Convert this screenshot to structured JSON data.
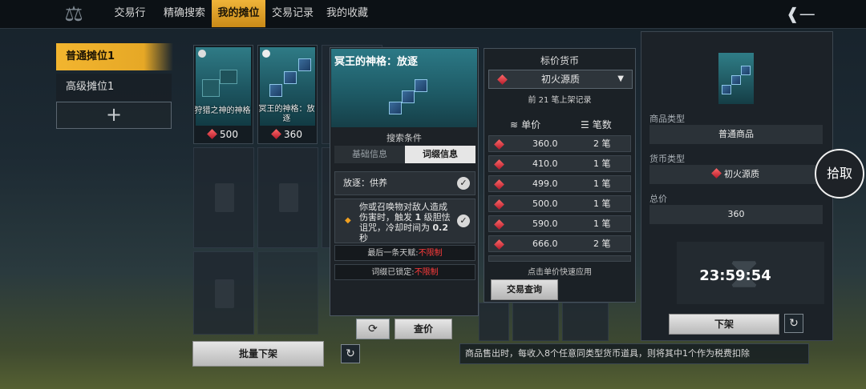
{
  "topbar": {
    "tabs": [
      "交易行",
      "精确搜索",
      "我的摊位",
      "交易记录",
      "我的收藏"
    ],
    "active_tab": "我的摊位",
    "accent": "#f0b43a"
  },
  "sidebar": {
    "stalls": [
      "普通摊位1",
      "高级摊位1"
    ],
    "add_label": "+"
  },
  "listings": [
    {
      "name": "狩猎之神的神格",
      "price": "500"
    },
    {
      "name": "冥王的神格：放逐",
      "price": "360"
    }
  ],
  "bulk_delist_label": "批量下架",
  "search_panel": {
    "item_title": "冥王的神格：放逐",
    "subtitle": "搜索条件",
    "tabs": [
      "基础信息",
      "词缀信息"
    ],
    "active_tab": "词缀信息",
    "affix_1": "放逐：供养",
    "affix_2_prefix": "你或召唤物对敌人造成伤害时，触发 ",
    "affix_2_num": "1",
    "affix_2_mid": " 级胆怯诅咒，冷却时间为 ",
    "affix_2_cd": "0.2",
    "affix_2_suffix": " 秒",
    "last_talent_label": "最后一条天赋:",
    "last_talent_value": "不限制",
    "locked_label": "词缀已锁定:",
    "locked_value": "不限制",
    "check_price_label": "查价"
  },
  "price_panel": {
    "title": "标价货币",
    "currency": "初火源质",
    "note": "前 21 笔上架记录",
    "col_price": "单价",
    "col_count": "笔数",
    "rows": [
      {
        "price": "360.0",
        "count": "2 笔"
      },
      {
        "price": "410.0",
        "count": "1 笔"
      },
      {
        "price": "499.0",
        "count": "1 笔"
      },
      {
        "price": "500.0",
        "count": "1 笔"
      },
      {
        "price": "590.0",
        "count": "1 笔"
      },
      {
        "price": "666.0",
        "count": "2 笔"
      }
    ],
    "hint": "点击单价快速应用",
    "query_label": "交易查询"
  },
  "detail": {
    "type_label": "商品类型",
    "type_value": "普通商品",
    "currency_label": "货币类型",
    "currency_value": "初火源质",
    "total_label": "总价",
    "total_value": "360",
    "timer": "23:59:54",
    "delist_label": "下架"
  },
  "pickup_label": "拾取",
  "tax_note": "商品售出时，每收入8个任意同类型货币道具，则将其中1个作为税费扣除"
}
